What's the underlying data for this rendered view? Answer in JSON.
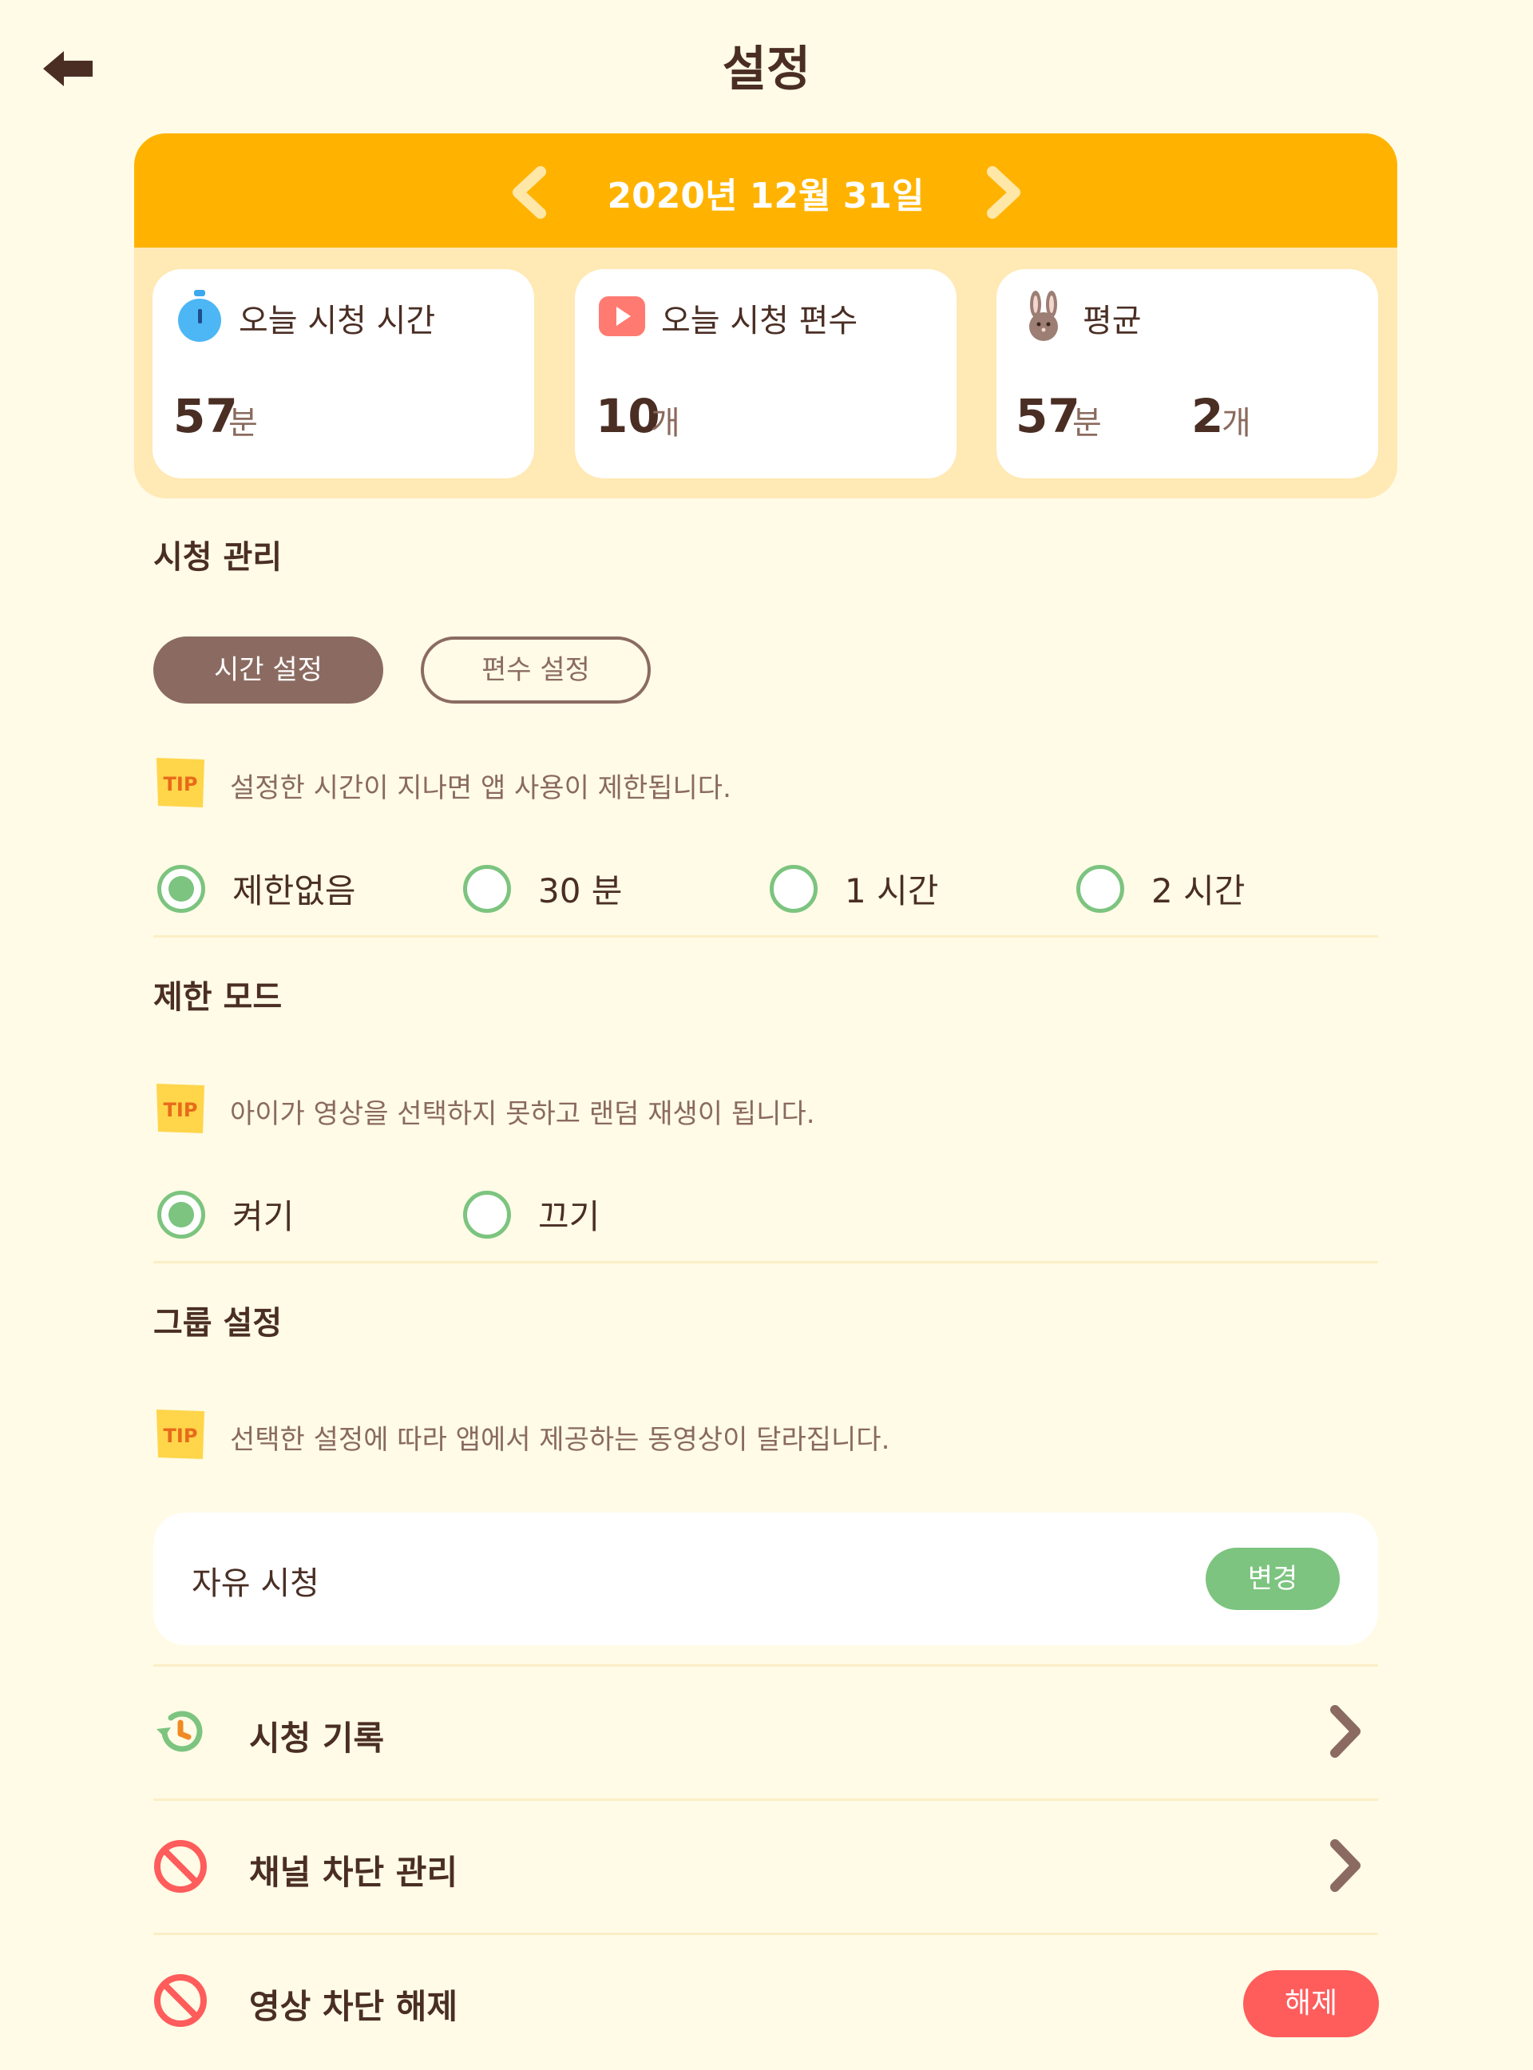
{
  "header": {
    "title": "설정",
    "back_icon": "back-arrow-icon"
  },
  "date_nav": {
    "date": "2020년 12월 31일",
    "prev_icon": "chevron-left-icon",
    "next_icon": "chevron-right-icon"
  },
  "stats": {
    "watch_time": {
      "label": "오늘 시청 시간",
      "value": "57",
      "unit": "분",
      "icon": "stopwatch-icon"
    },
    "watch_count": {
      "label": "오늘 시청 편수",
      "value": "10",
      "unit": "개",
      "icon": "play-icon"
    },
    "average": {
      "label": "평균",
      "time_value": "57",
      "time_unit": "분",
      "count_value": "2",
      "count_unit": "개",
      "icon": "rabbit-icon"
    }
  },
  "watch_management": {
    "title": "시청 관리",
    "tabs": [
      {
        "label": "시간 설정",
        "active": true
      },
      {
        "label": "편수 설정",
        "active": false
      }
    ],
    "tip": {
      "badge": "TIP",
      "text": "설정한 시간이 지나면 앱 사용이 제한됩니다."
    },
    "options": [
      {
        "label": "제한없음",
        "checked": true
      },
      {
        "label": "30 분",
        "checked": false
      },
      {
        "label": "1 시간",
        "checked": false
      },
      {
        "label": "2 시간",
        "checked": false
      }
    ]
  },
  "restrict_mode": {
    "title": "제한 모드",
    "tip": {
      "badge": "TIP",
      "text": "아이가 영상을 선택하지 못하고 랜덤 재생이 됩니다."
    },
    "options": [
      {
        "label": "켜기",
        "checked": true
      },
      {
        "label": "끄기",
        "checked": false
      }
    ]
  },
  "group_settings": {
    "title": "그룹 설정",
    "tip": {
      "badge": "TIP",
      "text": "선택한 설정에 따라 앱에서 제공하는 동영상이 달라집니다."
    },
    "current_group": "자유 시청",
    "change_label": "변경"
  },
  "menu": {
    "history": {
      "label": "시청 기록",
      "icon": "history-icon"
    },
    "channel_block": {
      "label": "채널 차단 관리",
      "icon": "block-icon"
    },
    "video_unblock": {
      "label": "영상 차단 해제",
      "icon": "block-icon",
      "action_label": "해제"
    }
  },
  "colors": {
    "background": "#FFFBE6",
    "accent_orange": "#FFB300",
    "accent_brown": "#8B6B61",
    "accent_green": "#7CC47F",
    "accent_red": "#FF5C5C"
  }
}
